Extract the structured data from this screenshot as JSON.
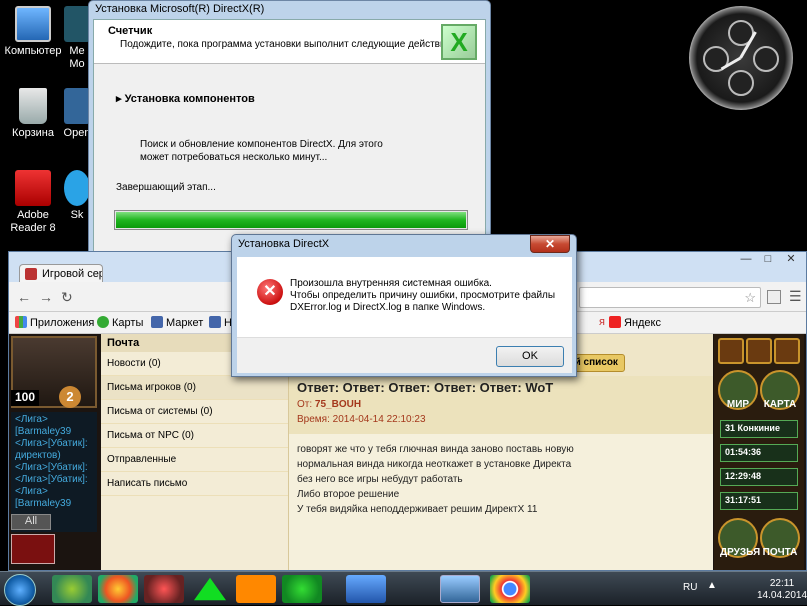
{
  "desktop": {
    "icons": [
      {
        "label": "Компьютер"
      },
      {
        "label": "Корзина"
      },
      {
        "label": "Adobe Reader 8"
      },
      {
        "label": "Me Mo"
      },
      {
        "label": "Open"
      },
      {
        "label": "Sk"
      }
    ]
  },
  "installer": {
    "title": "Установка Microsoft(R) DirectX(R)",
    "header_title": "Счетчик",
    "header_subtitle": "Подождите, пока программа установки выполнит следующие действия.",
    "logo": "X",
    "step": "Установка компонентов",
    "description": "Поиск и обновление компонентов DirectX. Для этого может потребоваться несколько минут...",
    "stage": "Завершающий этап...",
    "progress": 1.0
  },
  "browser": {
    "tab_title": "Игровой сер",
    "bookmarks": [
      "Приложения",
      "Карты",
      "Маркет",
      "Н",
      "я",
      "Яндекс"
    ],
    "mail": {
      "nav_title": "Почта",
      "nav_items": [
        "Новости (0)",
        "Письма игроков (0)",
        "Письма от системы (0)",
        "Письма от NPC (0)",
        "Отправленные",
        "Написать письмо"
      ],
      "list_button": "ый список",
      "subject": "Ответ: Ответ: Ответ: Ответ: Ответ: WoT",
      "from_label": "От:",
      "from_value": "75_BOUH",
      "date_label": "Время:",
      "date_value": "2014-04-14 22:10:23",
      "body_lines": [
        "говорят же что у тебя глючная винда заново поставь новую",
        "нормальная винда никогда неоткажет в установке Директа",
        "без него все игры небудут работать",
        "Либо второе решение",
        "У тебя видяйка неподдерживает решим ДиректХ 11"
      ]
    },
    "game_left": {
      "hp": "100",
      "level": "2",
      "chat": [
        "<Лига>[Barmaley39",
        "<Лига>[Убатик]:",
        "директов)",
        "<Лига>[Убатик]:",
        "<Лига>[Убатик]:",
        "<Лига>[Barmaley39"
      ],
      "chat_tab": "All"
    },
    "game_right": {
      "world": "МИР",
      "map": "КАРТА",
      "events": [
        "31 Конкиние",
        "01:54:36",
        "12:29:48",
        "31:17:51"
      ],
      "friends": "ДРУЗЬЯ",
      "mail": "ПОЧТА"
    }
  },
  "error_dialog": {
    "title": "Установка DirectX",
    "close": "✕",
    "icon": "✕",
    "line1": "Произошла внутренняя системная ошибка.",
    "line2": "Чтобы определить причину ошибки, просмотрите файлы",
    "line3": "DXError.log и DirectX.log в папке Windows.",
    "ok": "OK"
  },
  "taskbar": {
    "lang": "RU",
    "time": "22:11",
    "date": "14.04.2014",
    "apps": [
      "firefox-icon",
      "chrome-alt-icon",
      "crossfire-icon",
      "aion-icon",
      "ok-icon",
      "at-icon",
      "word-icon",
      "network-icon",
      "chrome-icon"
    ]
  }
}
